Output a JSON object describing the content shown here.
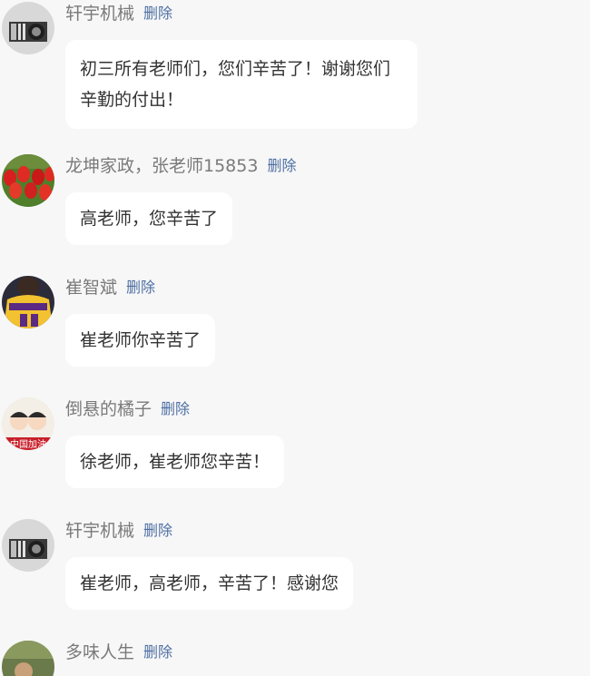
{
  "delete_label": "删除",
  "comments": [
    {
      "user": "轩宇机械",
      "text": "初三所有老师们，您们辛苦了！谢谢您们辛勤的付出！",
      "avatar": "machine-avatar"
    },
    {
      "user": "龙坤家政，张老师15853",
      "text": "高老师，您辛苦了",
      "avatar": "tulip-avatar"
    },
    {
      "user": "崔智斌",
      "text": "崔老师你辛苦了",
      "avatar": "jersey-avatar"
    },
    {
      "user": "倒悬的橘子",
      "text": "徐老师，崔老师您辛苦！",
      "avatar": "cartoon-avatar",
      "avatar_text": "中国加油"
    },
    {
      "user": "轩宇机械",
      "text": "崔老师，高老师，辛苦了！感谢您",
      "avatar": "machine-avatar"
    },
    {
      "user": "多味人生",
      "text": "",
      "avatar": "photo-avatar"
    }
  ]
}
